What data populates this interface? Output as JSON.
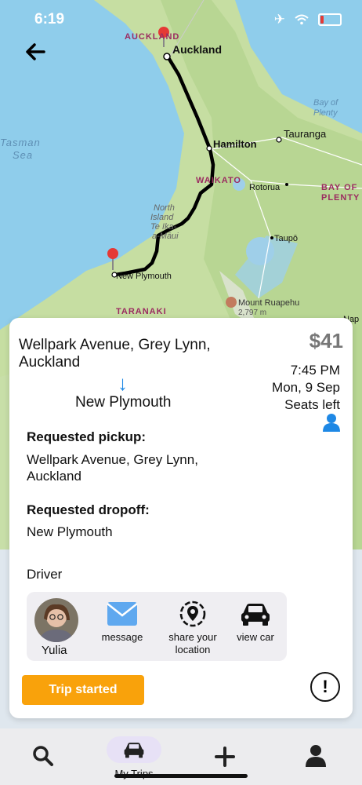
{
  "status_bar": {
    "time": "6:19"
  },
  "map": {
    "places": {
      "auckland_region": "AUCKLAND",
      "auckland": "Auckland",
      "bay_of_plenty": "Bay of\nPlenty",
      "tasman_sea": "Tasman\nSea",
      "hamilton": "Hamilton",
      "tauranga": "Tauranga",
      "waikato": "WAIKATO",
      "rotorua": "Rotorua",
      "bay_of_plenty_region": "BAY OF\nPLENTY",
      "north_island": "North\nIsland\nTe Ika-\na-Māui",
      "taupo": "Taupō",
      "new_plymouth": "New Plymouth",
      "mount_ruapehu": "Mount Ruapehu",
      "ruapehu_height": "2,797 m",
      "taranaki": "TARANAKI",
      "napier_partial": "Nap"
    }
  },
  "trip": {
    "from": "Wellpark Avenue, Grey Lynn, Auckland",
    "arrow": "↓",
    "to": "New Plymouth",
    "price": "$41",
    "time": "7:45 PM",
    "date": "Mon, 9 Sep",
    "seats": "Seats left",
    "pickup_heading": "Requested pickup:",
    "pickup_value": "Wellpark Avenue, Grey Lynn, Auckland",
    "dropoff_heading": "Requested dropoff:",
    "dropoff_value": "New Plymouth"
  },
  "driver": {
    "label": "Driver",
    "name": "Yulia",
    "actions": {
      "message": "message",
      "share_location": "share your location",
      "view_car": "view car"
    }
  },
  "buttons": {
    "trip_started": "Trip started",
    "alert": "!"
  },
  "tabs": {
    "my_trips": "My Trips"
  },
  "colors": {
    "accent_orange": "#f9a20b",
    "route": "#000000",
    "pin": "#e53935",
    "blue": "#1e88e5"
  }
}
